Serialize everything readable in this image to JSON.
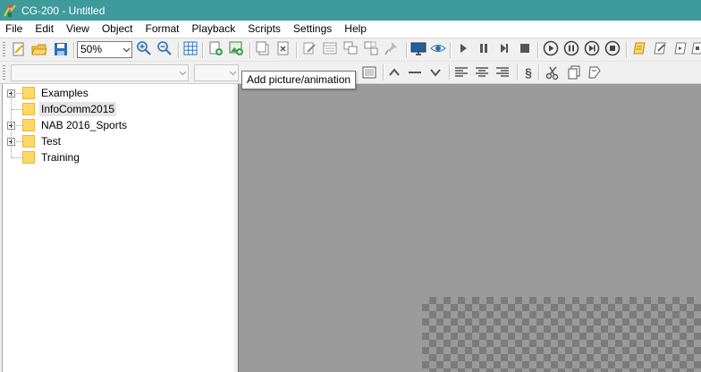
{
  "window": {
    "title": "CG-200 - Untitled"
  },
  "menu": [
    "File",
    "Edit",
    "View",
    "Object",
    "Format",
    "Playback",
    "Scripts",
    "Settings",
    "Help"
  ],
  "toolbar": {
    "zoom_value": "50%",
    "buttons": [
      {
        "icon": "new-document-icon"
      },
      {
        "icon": "open-folder-icon"
      },
      {
        "icon": "save-icon"
      },
      {
        "icon": "zoom-in-icon"
      },
      {
        "icon": "zoom-out-icon"
      },
      {
        "icon": "grid-icon"
      },
      {
        "icon": "add-page-icon"
      },
      {
        "icon": "add-picture-icon"
      },
      {
        "icon": "copy-page-icon"
      },
      {
        "icon": "delete-page-icon"
      },
      {
        "icon": "edit-icon"
      },
      {
        "icon": "properties-icon"
      },
      {
        "icon": "group-icon"
      },
      {
        "icon": "ungroup-icon"
      },
      {
        "icon": "pin-icon"
      },
      {
        "icon": "monitor-icon"
      },
      {
        "icon": "preview-eye-icon"
      },
      {
        "icon": "play-icon"
      },
      {
        "icon": "pause-icon"
      },
      {
        "icon": "step-icon"
      },
      {
        "icon": "stop-icon"
      },
      {
        "icon": "play-all-icon"
      },
      {
        "icon": "pause-all-icon"
      },
      {
        "icon": "next-all-icon"
      },
      {
        "icon": "stop-all-icon"
      },
      {
        "icon": "script-icon"
      },
      {
        "icon": "script-edit-icon"
      },
      {
        "icon": "script-run-icon"
      },
      {
        "icon": "script-stop-icon"
      }
    ]
  },
  "format_toolbar": {
    "font_value": "",
    "size_value": "",
    "section_symbol": "§"
  },
  "tooltip": "Add picture/animation",
  "tree": [
    {
      "label": "Examples",
      "expandable": true
    },
    {
      "label": "InfoComm2015",
      "expandable": false,
      "selected": true
    },
    {
      "label": "NAB 2016_Sports",
      "expandable": true
    },
    {
      "label": "Test",
      "expandable": true
    },
    {
      "label": "Training",
      "expandable": false
    }
  ],
  "colors": {
    "titlebar": "#3f9a9b",
    "canvas": "#9b9b9b",
    "folder": "#ffd866"
  }
}
